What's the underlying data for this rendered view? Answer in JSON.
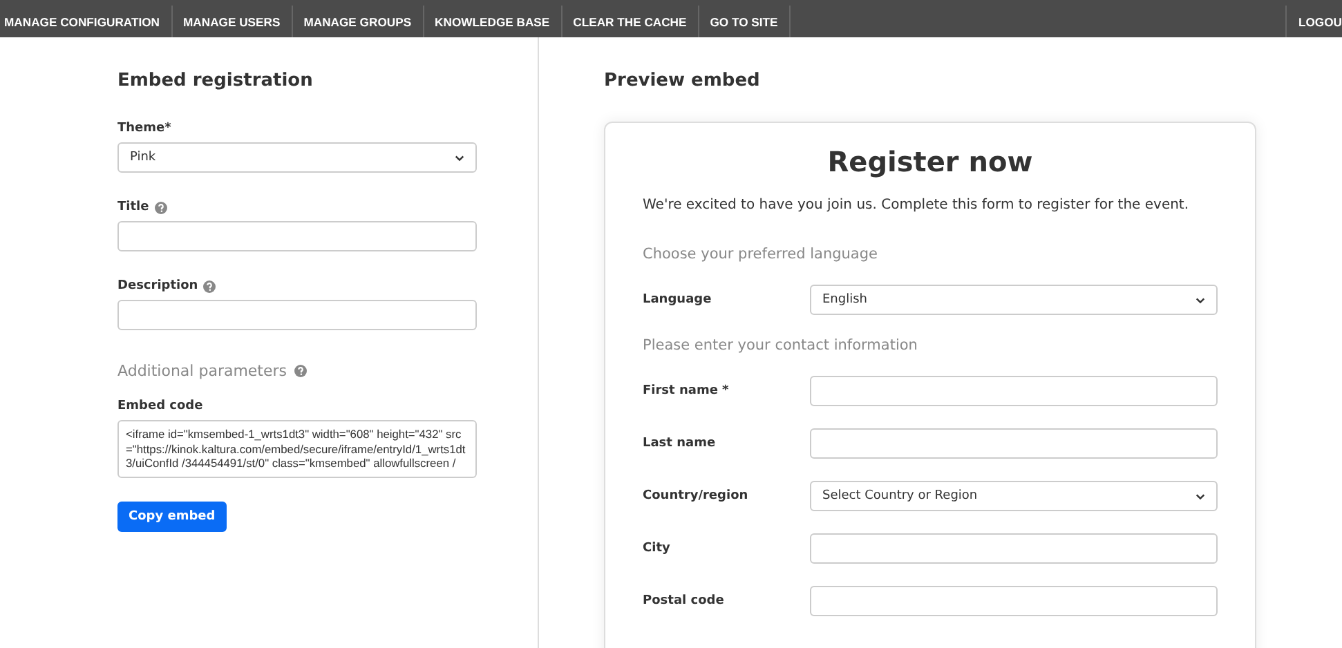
{
  "nav": {
    "items": [
      {
        "label": "MANAGE CONFIGURATION"
      },
      {
        "label": "MANAGE USERS"
      },
      {
        "label": "MANAGE GROUPS"
      },
      {
        "label": "KNOWLEDGE BASE"
      },
      {
        "label": "CLEAR THE CACHE"
      },
      {
        "label": "GO TO SITE"
      }
    ],
    "logout": "LOGOU"
  },
  "embed_registration": {
    "title": "Embed registration",
    "fields": [
      {
        "kind": "select",
        "label": "Theme*",
        "value": "Pink",
        "help": false
      },
      {
        "kind": "text",
        "label": "Title",
        "help": true
      },
      {
        "kind": "text",
        "label": "Description",
        "help": true
      }
    ],
    "additional_parameters": {
      "label": "Additional parameters",
      "help": true
    },
    "embed_code": {
      "label": "Embed code",
      "value": "<iframe id=\"kmsembed-1_wrts1dt3\" width=\"608\" height=\"432\" src=\"https://kinok.kaltura.com/embed/secure/iframe/entryId/1_wrts1dt3/uiConfId /344454491/st/0\" class=\"kmsembed\" allowfullscreen /"
    },
    "copy_button": "Copy embed"
  },
  "preview": {
    "title": "Preview embed",
    "form": {
      "heading": "Register now",
      "intro": "We're excited to have you join us. Complete this form to register for the event.",
      "sections": [
        {
          "title": "Choose your preferred language",
          "rows": [
            {
              "kind": "select",
              "label": "Language",
              "value": "English"
            }
          ]
        },
        {
          "title": "Please enter your contact information",
          "rows": [
            {
              "kind": "text",
              "label": "First name *"
            },
            {
              "kind": "text",
              "label": "Last name"
            },
            {
              "kind": "select",
              "label": "Country/region",
              "value": "Select Country or Region"
            },
            {
              "kind": "text",
              "label": "City"
            },
            {
              "kind": "text",
              "label": "Postal code"
            }
          ]
        }
      ]
    }
  }
}
